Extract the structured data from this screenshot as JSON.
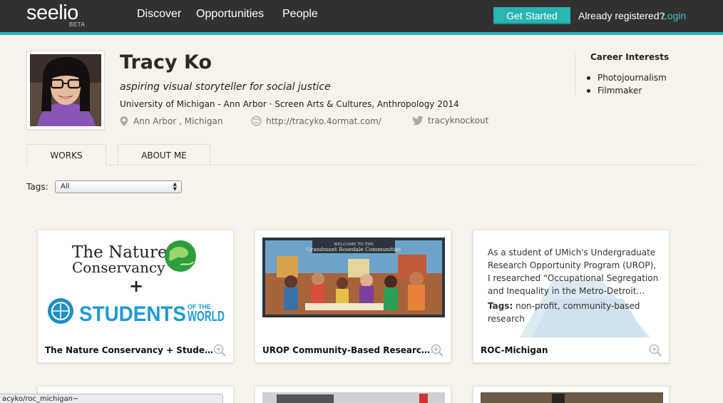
{
  "nav": {
    "logo": "seelio",
    "logo_badge": "BETA",
    "links": [
      "Discover",
      "Opportunities",
      "People"
    ],
    "get_started": "Get Started",
    "already_registered": "Already registered?",
    "login": "Login"
  },
  "profile": {
    "name": "Tracy Ko",
    "tagline": "aspiring visual storyteller for social justice",
    "school": "University of Michigan - Ann Arbor · Screen Arts & Cultures, Anthropology 2014",
    "location": "Ann Arbor , Michigan",
    "website": "http://tracyko.4ormat.com/",
    "twitter": "tracyknockout"
  },
  "career": {
    "title": "Career Interests",
    "items": [
      "Photojournalism",
      "Filmmaker"
    ]
  },
  "tabs": [
    "WORKS",
    "ABOUT ME"
  ],
  "filter": {
    "label": "Tags:",
    "selected": "All"
  },
  "cards": [
    {
      "title": "The Nature Conservancy + Students of the World",
      "logo_text_1": "The Nature",
      "logo_text_2": "Conservancy",
      "logo_plus": "+",
      "logo_text_3": "STUDENTS",
      "logo_text_4": "OF THE",
      "logo_text_5": "WORLD"
    },
    {
      "title": "UROP Community-Based Research Project",
      "image_caption_1": "WELCOME TO THE",
      "image_caption_2": "Grandmont Rosedale Communities"
    },
    {
      "title": "ROC-Michigan",
      "text": "As a student of UMich's Undergraduate Research Opportunity Program (UROP), I researched “Occupational Segregation and Inequality in the Metro-Detroit…",
      "tags_label": "Tags:",
      "tags": "non-profit, community-based research"
    }
  ],
  "status_url": "acyko/roc_michigan~",
  "colors": {
    "topbar": "#333130",
    "accent": "#26b3b6",
    "background": "#f7f3ea",
    "link": "#3cc3c4"
  }
}
